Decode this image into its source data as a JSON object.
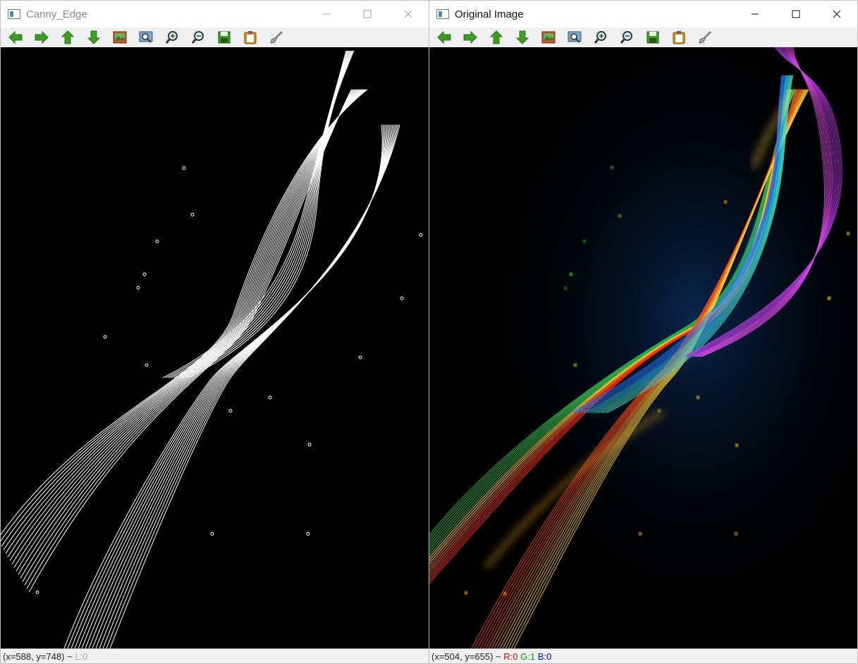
{
  "windows": [
    {
      "title": "Canny_Edge",
      "status": {
        "coords": "(x=588, y=748) ~ ",
        "value_label": "L:0"
      }
    },
    {
      "title": "Original Image",
      "status": {
        "coords": "(x=504, y=655) ~ ",
        "r": "R:0",
        "g": "G:1",
        "b": "B:0"
      }
    }
  ],
  "toolbar_icons": [
    "arrow-left-icon",
    "arrow-right-icon",
    "arrow-up-icon",
    "arrow-down-icon",
    "image-icon",
    "zoom-region-icon",
    "zoom-in-icon",
    "zoom-out-icon",
    "save-icon",
    "clipboard-icon",
    "brush-icon"
  ],
  "colors": {
    "toolbar_green": "#3a9d23",
    "canvas": "#000000"
  }
}
